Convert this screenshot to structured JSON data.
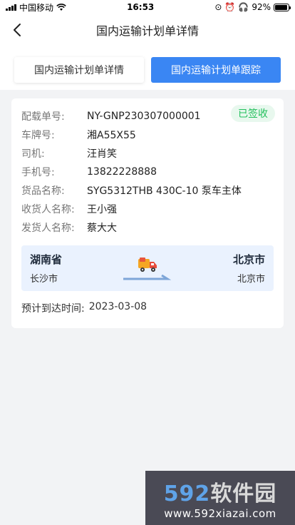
{
  "status_bar": {
    "carrier": "中国移动",
    "time": "16:53",
    "battery": "92%",
    "battery_level": 0.92
  },
  "header": {
    "title": "国内运输计划单详情"
  },
  "tabs": [
    {
      "label": "国内运输计划单详情",
      "active": false
    },
    {
      "label": "国内运输计划单跟踪",
      "active": true
    }
  ],
  "details": {
    "status_badge": "已签收",
    "fields": [
      {
        "label": "配载单号:",
        "value": "NY-GNP230307000001"
      },
      {
        "label": "车牌号:",
        "value": "湘A55X55"
      },
      {
        "label": "司机:",
        "value": "汪肖笑"
      },
      {
        "label": "手机号:",
        "value": "13822228888"
      },
      {
        "label": "货品名称:",
        "value": "SYG5312THB 430C-10 泵车主体"
      },
      {
        "label": "收货人名称:",
        "value": "王小强"
      },
      {
        "label": "发货人名称:",
        "value": "蔡大大"
      }
    ]
  },
  "route": {
    "from_province": "湖南省",
    "from_city": "长沙市",
    "to_province": "北京市",
    "to_city": "北京市",
    "icon": "truck-icon"
  },
  "eta": {
    "label": "预计到达时间:",
    "value": "2023-03-08"
  },
  "watermark": {
    "number": "592",
    "name": "软件园",
    "url": "www.592xiazai.com"
  },
  "colors": {
    "accent": "#3a86f3",
    "badge_green": "#24c05d",
    "route_bg": "#eaf2fe"
  }
}
